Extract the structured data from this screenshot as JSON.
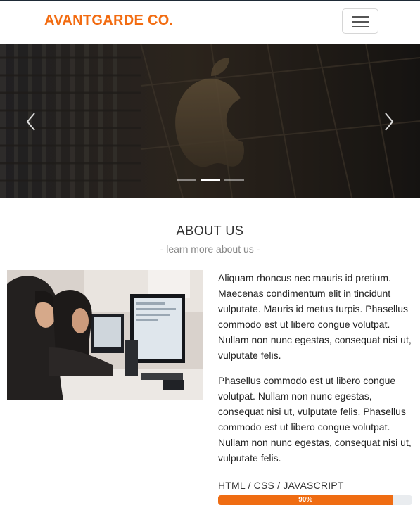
{
  "navbar": {
    "brand": "AVANTGARDE CO.",
    "brand_color": "#f26b10",
    "toggler_icon": "hamburger-icon"
  },
  "hero": {
    "slide_count": 3,
    "active_slide": 2,
    "prev_icon": "chevron-left-icon",
    "next_icon": "chevron-right-icon"
  },
  "about": {
    "title": "ABOUT US",
    "subtitle": "- learn more about us -",
    "paragraph_1": "Aliquam rhoncus nec mauris id pretium. Maecenas condimentum elit in tincidunt vulputate. Mauris id metus turpis. Phasellus commodo est ut libero congue volutpat. Nullam non nunc egestas, consequat nisi ut, vulputate felis.",
    "paragraph_2": "Phasellus commodo est ut libero congue volutpat. Nullam non nunc egestas, consequat nisi ut, vulputate felis. Phasellus commodo est ut libero congue volutpat. Nullam non nunc egestas, consequat nisi ut, vulputate felis."
  },
  "skill": {
    "label": "HTML / CSS / JAVASCRIPT",
    "percent": 90,
    "percent_text": "90%",
    "bar_color": "#ef6c12"
  }
}
